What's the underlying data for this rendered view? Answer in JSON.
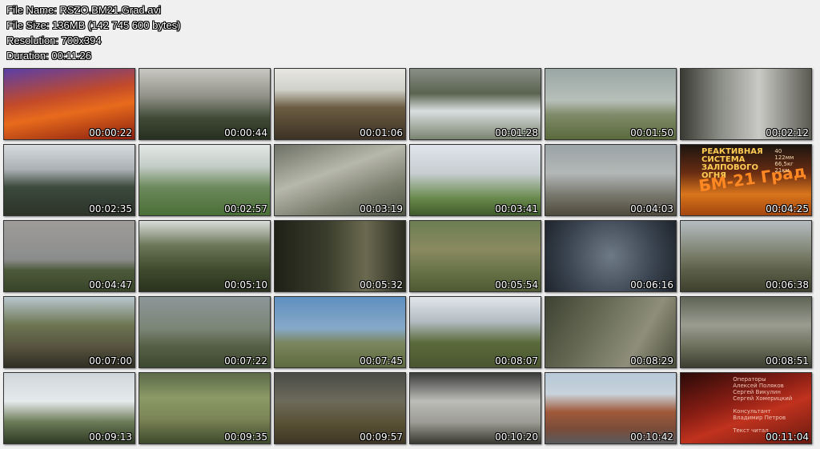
{
  "file_info": {
    "file_name": "File Name: RSZO.BM21.Grad.avi",
    "file_size": "File Size: 136MB (142 745 600 bytes)",
    "resolution": "Resolution: 700x394",
    "duration": "Duration: 00:11:26"
  },
  "thumbnails": [
    {
      "time": "00:00:22",
      "bg": "linear-gradient(170deg,#5a3fa8 0%,#c24a2a 40%,#e86b1c 60%,#8a1f10 100%)"
    },
    {
      "time": "00:00:44",
      "bg": "linear-gradient(180deg,#c9c9c3 0%,#8f8f86 40%,#3f4a36 70%,#27301f 100%)"
    },
    {
      "time": "00:01:06",
      "bg": "linear-gradient(180deg,#e8e8e2 0%,#cfd0c8 30%,#6b5c42 55%,#3e3224 100%)"
    },
    {
      "time": "00:01:28",
      "bg": "linear-gradient(180deg,#8a8f86 0%,#5a6350 35%,#d9dfe0 60%,#7b8470 100%)"
    },
    {
      "time": "00:01:50",
      "bg": "linear-gradient(180deg,#9aa7a5 0%,#b7bfb9 45%,#7f8b6a 65%,#5a6a3c 100%)"
    },
    {
      "time": "00:02:12",
      "bg": "linear-gradient(90deg,#3a3a34 0%,#8a8c86 30%,#c9c9c5 60%,#5a5a52 100%)"
    },
    {
      "time": "00:02:35",
      "bg": "linear-gradient(180deg,#d6dbe0 0%,#aab0b4 35%,#3b4a3c 60%,#2c3329 100%)"
    },
    {
      "time": "00:02:57",
      "bg": "linear-gradient(180deg,#e3e8e5 0%,#c4cdc8 30%,#6c8a5c 60%,#4a6e36 100%)"
    },
    {
      "time": "00:03:19",
      "bg": "linear-gradient(160deg,#6d7064 0%,#b7b8ac 40%,#7c7f6e 70%,#4d5444 100%)"
    },
    {
      "time": "00:03:41",
      "bg": "linear-gradient(180deg,#dfe5ea 0%,#c7ced2 40%,#6a8b4e 75%,#3f5a2a 100%)"
    },
    {
      "time": "00:04:03",
      "bg": "linear-gradient(180deg,#9aa3a6 0%,#b3b7b6 40%,#7a7a70 70%,#4e4a3c 100%)"
    },
    {
      "time": "00:04:25",
      "bg": "linear-gradient(180deg,#1c1410 0%,#6a2d12 40%,#d8751c 70%,#a4450e 100%)"
    },
    {
      "time": "00:04:47",
      "bg": "linear-gradient(180deg,#9f9c99 0%,#8a8c8c 55%,#4d5a3a 70%,#384428 100%)"
    },
    {
      "time": "00:05:10",
      "bg": "linear-gradient(180deg,#dadedb 0%,#6b7558 35%,#3f4a2c 70%,#2a321e 100%)"
    },
    {
      "time": "00:05:32",
      "bg": "linear-gradient(90deg,#1e2016 0%,#3a3d2c 40%,#6b6a50 70%,#2a2b20 100%)"
    },
    {
      "time": "00:05:54",
      "bg": "linear-gradient(180deg,#6c7d52 0%,#8a8a60 40%,#6a7448 70%,#4e5a34 100%)"
    },
    {
      "time": "00:06:16",
      "bg": "radial-gradient(circle at 50% 50%,#6e7a86 0%,#3a4450 60%,#1e242c 100%)"
    },
    {
      "time": "00:06:38",
      "bg": "linear-gradient(180deg,#b5bcc0 0%,#7d8270 45%,#5c5f48 70%,#3e402e 100%)"
    },
    {
      "time": "00:07:00",
      "bg": "linear-gradient(180deg,#b8c7ce 0%,#6c7552 40%,#585440 70%,#2f2e22 100%)"
    },
    {
      "time": "00:07:22",
      "bg": "linear-gradient(180deg,#8d9698 0%,#7a8576 45%,#566045 70%,#3d4830 100%)"
    },
    {
      "time": "00:07:45",
      "bg": "linear-gradient(180deg,#5e8fc0 0%,#86a9c8 45%,#7c8660 65%,#5e6a3e 100%)"
    },
    {
      "time": "00:08:07",
      "bg": "linear-gradient(180deg,#e2e6ea 0%,#b2bcc2 35%,#5a6a3a 65%,#4a5630 100%)"
    },
    {
      "time": "00:08:29",
      "bg": "linear-gradient(120deg,#3e4232 0%,#6a6e58 40%,#8e8e7a 70%,#4a4c3a 100%)"
    },
    {
      "time": "00:08:51",
      "bg": "linear-gradient(180deg,#5e6456 0%,#9a9c90 40%,#6c705c 70%,#3c3e30 100%)"
    },
    {
      "time": "00:09:13",
      "bg": "linear-gradient(180deg,#cfd6da 0%,#e6eaec 40%,#6a7a56 70%,#2e3a24 100%)"
    },
    {
      "time": "00:09:35",
      "bg": "linear-gradient(180deg,#5c6a48 0%,#8a9a66 35%,#7c8456 65%,#3e4a2c 100%)"
    },
    {
      "time": "00:09:57",
      "bg": "linear-gradient(180deg,#4a4c46 0%,#6c6a5a 40%,#5a5236 70%,#3e3624 100%)"
    },
    {
      "time": "00:10:20",
      "bg": "linear-gradient(180deg,#3a3c3a 0%,#bcbcb8 40%,#9c9c94 70%,#3a3a32 100%)"
    },
    {
      "time": "00:10:42",
      "bg": "linear-gradient(180deg,#b6c8d8 0%,#c8d2da 30%,#a05a3a 55%,#7a4c3a 80%,#5a5a5e 100%)"
    },
    {
      "time": "00:11:04",
      "bg": "linear-gradient(160deg,#2a0a08 0%,#8a1e14 40%,#c0321e 60%,#6a1a10 100%)"
    }
  ],
  "overlays": {
    "t12": {
      "logo_lines": [
        "Реактивная",
        "система",
        "залпового",
        "огня"
      ],
      "big_text": "БМ-21 Град",
      "spec_lines": [
        "40",
        "122мм",
        "66,5кг",
        "21км"
      ]
    },
    "t30": {
      "credit_lines": [
        "Операторы",
        "Алексей Поляков",
        "Сергей Викулин",
        "Сергей Хомерицкий",
        "",
        "Консультант",
        "Владимир Петров",
        "",
        "Текст читал"
      ]
    }
  }
}
